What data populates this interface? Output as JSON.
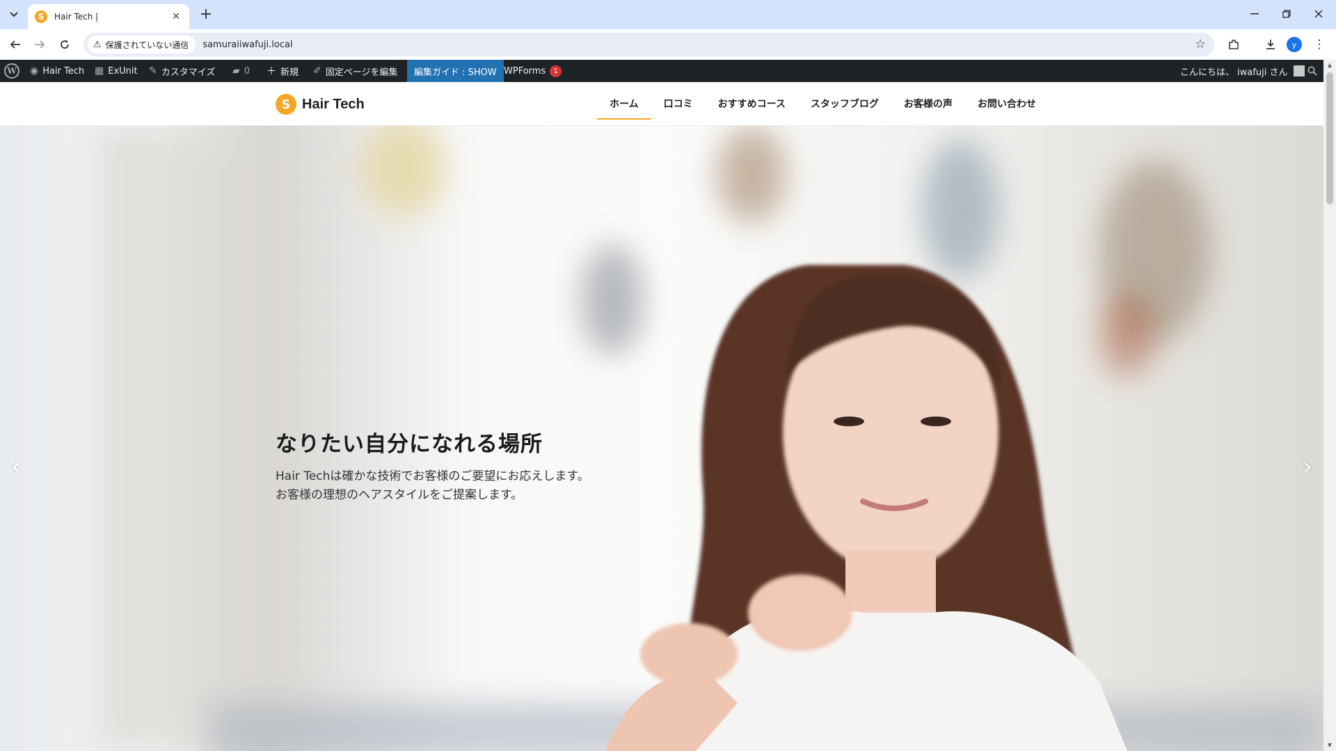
{
  "browser": {
    "tab_title": "Hair Tech |",
    "tab_favicon_letter": "S",
    "new_tab_label": "+",
    "security_label": "保護されていない通信",
    "url": "samuraiiwafuji.local",
    "profile_initial": "y"
  },
  "adminbar": {
    "site_name": "Hair Tech",
    "exunit": "ExUnit",
    "customize": "カスタマイズ",
    "comments_count": "0",
    "new": "新規",
    "edit_page": "固定ページを編集",
    "guide": "編集ガイド : SHOW",
    "wpforms": "WPForms",
    "wpforms_badge": "1",
    "greeting": "こんにちは、 iwafuji さん"
  },
  "site": {
    "logo_letter": "S",
    "logo_text": "Hair Tech",
    "nav": [
      {
        "label": "ホーム",
        "active": true
      },
      {
        "label": "口コミ"
      },
      {
        "label": "おすすめコース"
      },
      {
        "label": "スタッフブログ"
      },
      {
        "label": "お客様の声"
      },
      {
        "label": "お問い合わせ"
      }
    ]
  },
  "hero": {
    "title": "なりたい自分になれる場所",
    "line1": "Hair Techは確かな技術でお客様のご要望にお応えします。",
    "line2": "お客様の理想のヘアスタイルをご提案します。",
    "prev_arrow": "‹",
    "next_arrow": "›"
  },
  "colors": {
    "accent": "#f5a623",
    "adminbar_bg": "#1d2327",
    "guide_bg": "#2271b1",
    "badge": "#d63638"
  },
  "icons": [
    "tab-search-icon",
    "close-icon",
    "back-icon",
    "forward-icon",
    "reload-icon",
    "warning-icon",
    "star-icon",
    "extensions-icon",
    "download-icon",
    "menu-icon",
    "wordpress-icon",
    "dashboard-icon",
    "exunit-icon",
    "brush-icon",
    "comment-icon",
    "plus-icon",
    "pencil-icon",
    "search-icon",
    "chevron-left-icon",
    "chevron-right-icon"
  ]
}
